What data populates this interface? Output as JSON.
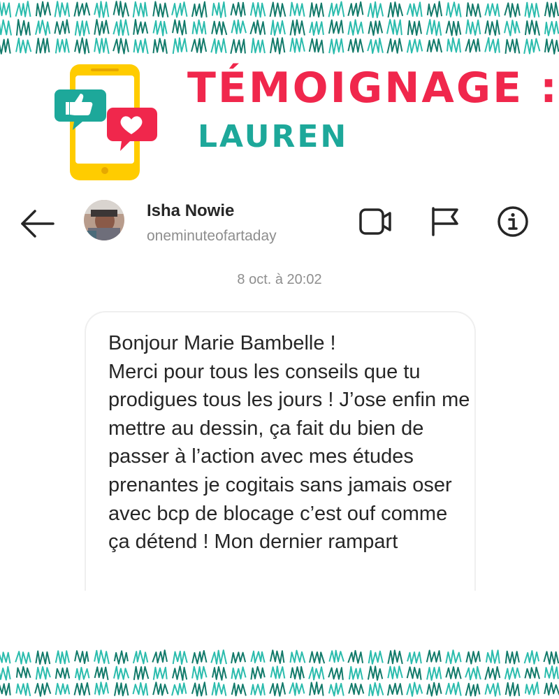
{
  "header": {
    "title": "TÉMOIGNAGE :",
    "subtitle": "LAUREN"
  },
  "chat": {
    "username": "Isha Nowie",
    "handle": "oneminuteofartaday",
    "timestamp": "8 oct. à 20:02",
    "message": "Bonjour Marie Bambelle !\nMerci pour tous les conseils que tu prodigues tous les jours ! J’ose enfin me mettre au dessin, ça fait du bien de passer à l’action avec mes études prenantes je cogitais sans jamais oser avec bcp de blocage c’est ouf comme ça détend ! Mon dernier rampart"
  },
  "icons": {
    "back": "arrow-left-icon",
    "video": "video-camera-icon",
    "flag": "flag-icon",
    "info": "info-icon",
    "illustration": "phone-like-heart-illustration"
  },
  "colors": {
    "title_red": "#f0274c",
    "title_teal": "#1da89a",
    "pattern_dark": "#127a6a",
    "pattern_light": "#2bbcad",
    "phone_yellow": "#ffcc00",
    "text_primary": "#262626",
    "text_secondary": "#8e8e8e"
  }
}
